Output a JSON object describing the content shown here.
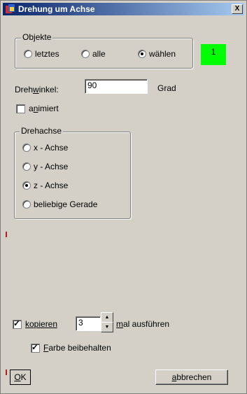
{
  "window": {
    "title": "Drehung um Achse",
    "close_label": "X"
  },
  "objekte": {
    "legend_pre": "Ob",
    "legend_u": "j",
    "legend_post": "ekte",
    "options": [
      {
        "label": "letztes",
        "checked": false
      },
      {
        "label": "alle",
        "checked": false
      },
      {
        "label": "wählen",
        "checked": true
      }
    ],
    "count": "1",
    "count_color": "#00ff00"
  },
  "drehwinkel": {
    "label_pre": "Dreh",
    "label_u": "w",
    "label_post": "inkel:",
    "value": "90",
    "unit": "Grad"
  },
  "animiert": {
    "label_pre": "a",
    "label_u": "n",
    "label_post": "imiert",
    "checked": false
  },
  "drehachse": {
    "legend": "Drehachse",
    "options": [
      {
        "label": "x - Achse",
        "checked": false
      },
      {
        "label": "y - Achse",
        "checked": false
      },
      {
        "label": "z - Achse",
        "checked": true
      },
      {
        "label": "beliebige Gerade",
        "checked": false
      }
    ]
  },
  "kopieren": {
    "label": "kopieren",
    "checked": true,
    "count": "3",
    "suffix_u": "m",
    "suffix_post": "al ausführen"
  },
  "farbe": {
    "label_u": "F",
    "label_post": "arbe beibehalten",
    "checked": true
  },
  "buttons": {
    "ok_u": "O",
    "ok_post": "K",
    "cancel_u": "a",
    "cancel_post": "bbrechen"
  }
}
